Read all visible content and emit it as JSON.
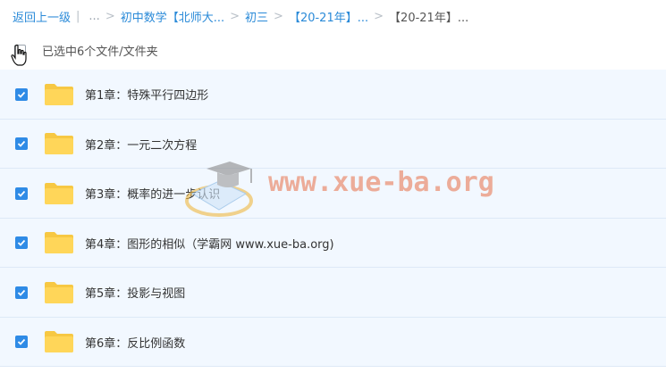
{
  "breadcrumb": {
    "back": "返回上一级",
    "ellipsis": "...",
    "items": [
      "初中数学【北师大...",
      "初三",
      "【20-21年】...",
      "【20-21年】..."
    ]
  },
  "selection": {
    "text": "已选中6个文件/文件夹"
  },
  "files": [
    {
      "name": "第1章：特殊平行四边形"
    },
    {
      "name": "第2章：一元二次方程"
    },
    {
      "name": "第3章：概率的进一步认识"
    },
    {
      "name": "第4章：图形的相似（学霸网 www.xue-ba.org)"
    },
    {
      "name": "第5章：投影与视图"
    },
    {
      "name": "第6章：反比例函数"
    }
  ],
  "watermark": {
    "text": "www.xue-ba.org"
  },
  "colors": {
    "accent": "#2f8be6",
    "link": "#2a8ad8",
    "row_bg": "#f2f8ff",
    "folder": "#ffd659"
  }
}
